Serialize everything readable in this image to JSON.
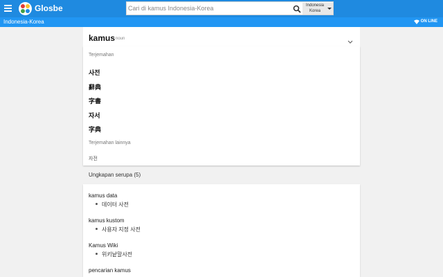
{
  "header": {
    "brand": "Glosbe",
    "search": {
      "placeholder": "Cari di kamus Indonesia-Korea",
      "value": ""
    },
    "language_select": {
      "line1": "Indonesia",
      "line2": "Korea"
    },
    "brand_color": "#1f8ae0"
  },
  "subbar": {
    "title": "Indonesia-Korea",
    "status": "ON LINE",
    "color": "#2196f3"
  },
  "entry": {
    "word": "kamus",
    "pos": "noun"
  },
  "translations": {
    "label": "Terjemahan",
    "items": [
      "사전",
      "辭典",
      "字書",
      "자서",
      "字典"
    ],
    "other_label": "Terjemahan lainnya",
    "other_items": [
      "자전"
    ]
  },
  "similar": {
    "header": "Ungkapan serupa (5)",
    "phrases": [
      {
        "term": "kamus data",
        "translation": "데이터 사전"
      },
      {
        "term": "kamus kustom",
        "translation": "사용자 지정 사전"
      },
      {
        "term": "Kamus Wiki",
        "translation": "위키낱말사전"
      },
      {
        "term": "pencarian kamus",
        "translation": ""
      }
    ]
  },
  "icons": [
    "menu-icon",
    "glosbe-logo-icon",
    "search-icon",
    "caret-down-icon",
    "wifi-icon",
    "chevron-down-icon"
  ]
}
